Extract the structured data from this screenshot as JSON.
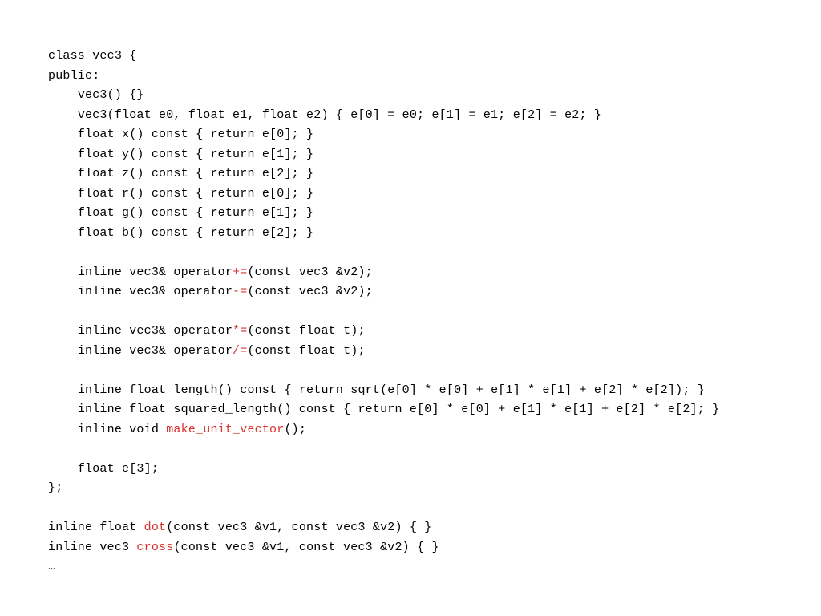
{
  "indent": "    ",
  "code": {
    "l01": "class vec3 {",
    "l02": "public:",
    "l03": "vec3() {}",
    "l04": "vec3(float e0, float e1, float e2) { e[0] = e0; e[1] = e1; e[2] = e2; }",
    "l05": "float x() const { return e[0]; }",
    "l06": "float y() const { return e[1]; }",
    "l07": "float z() const { return e[2]; }",
    "l08": "float r() const { return e[0]; }",
    "l09": "float g() const { return e[1]; }",
    "l10": "float b() const { return e[2]; }",
    "l12a": "inline vec3& operator",
    "l12b": "+=",
    "l12c": "(const vec3 &v2);",
    "l13a": "inline vec3& operator",
    "l13b": "-=",
    "l13c": "(const vec3 &v2);",
    "l15a": "inline vec3& operator",
    "l15b": "*=",
    "l15c": "(const float t);",
    "l16a": "inline vec3& operator",
    "l16b": "/=",
    "l16c": "(const float t);",
    "l18": "inline float length() const { return sqrt(e[0] * e[0] + e[1] * e[1] + e[2] * e[2]); }",
    "l19": "inline float squared_length() const { return e[0] * e[0] + e[1] * e[1] + e[2] * e[2]; }",
    "l20a": "inline void ",
    "l20b": "make_unit_vector",
    "l20c": "();",
    "l22": "float e[3];",
    "l23": "};",
    "l25a": "inline float ",
    "l25b": "dot",
    "l25c": "(const vec3 &v1, const vec3 &v2) { }",
    "l26a": "inline vec3 ",
    "l26b": "cross",
    "l26c": "(const vec3 &v1, const vec3 &v2) { }",
    "l27": "…"
  }
}
